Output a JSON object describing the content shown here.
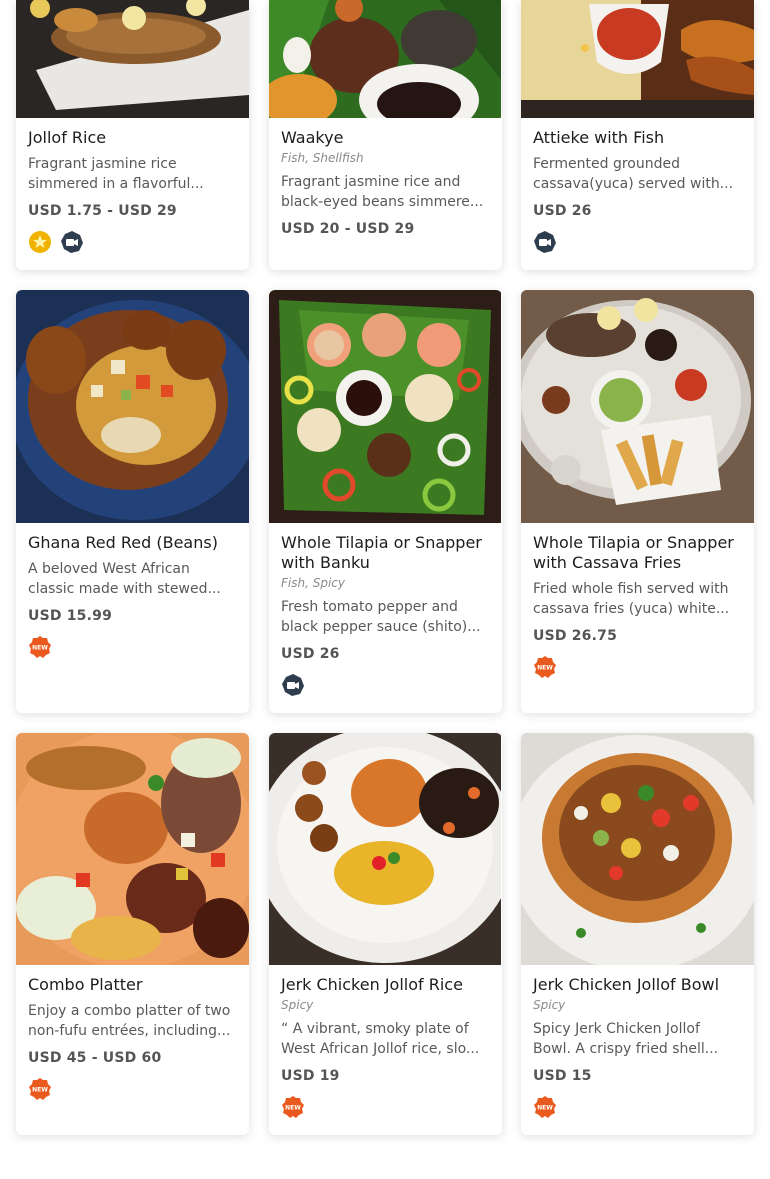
{
  "menu_items": [
    {
      "name": "Jollof Rice",
      "tags": "",
      "description": "Fragrant jasmine rice simmered in a flavorful...",
      "price": "USD 1.75 - USD 29",
      "badges": [
        "star-badge-icon",
        "video-badge-icon"
      ]
    },
    {
      "name": "Waakye",
      "tags": "Fish, Shellfish",
      "description": "Fragrant jasmine rice and black-eyed beans simmere...",
      "price": "USD 20 - USD 29",
      "badges": []
    },
    {
      "name": "Attieke with Fish",
      "tags": "",
      "description": "Fermented grounded cassava(yuca) served with...",
      "price": "USD 26",
      "badges": [
        "video-badge-icon"
      ]
    },
    {
      "name": "Ghana Red Red (Beans)",
      "tags": "",
      "description": "A beloved West African classic made with stewed...",
      "price": "USD 15.99",
      "badges": [
        "new-badge-icon"
      ],
      "badge_text": "NEW"
    },
    {
      "name": "Whole Tilapia or Snapper with Banku",
      "tags": "Fish, Spicy",
      "description": "Fresh tomato pepper and black pepper sauce (shito)...",
      "price": "USD 26",
      "badges": [
        "video-badge-icon"
      ]
    },
    {
      "name": "Whole Tilapia or Snapper with Cassava Fries",
      "tags": "",
      "description": "Fried whole fish served with cassava fries (yuca) white...",
      "price": "USD 26.75",
      "badges": [
        "new-badge-icon"
      ],
      "badge_text": "NEW"
    },
    {
      "name": "Combo Platter",
      "tags": "",
      "description": "Enjoy a combo platter of two non-fufu entrées, including...",
      "price": "USD 45 - USD 60",
      "badges": [
        "new-badge-icon"
      ],
      "badge_text": "NEW"
    },
    {
      "name": "Jerk Chicken Jollof Rice",
      "tags": "Spicy",
      "description": "“ A vibrant, smoky plate of West African Jollof rice, slo...",
      "price": "USD 19",
      "badges": [
        "new-badge-icon"
      ],
      "badge_text": "NEW"
    },
    {
      "name": "Jerk Chicken Jollof Bowl",
      "tags": "Spicy",
      "description": "Spicy Jerk Chicken Jollof Bowl. A crispy fried shell...",
      "price": "USD 15",
      "badges": [
        "new-badge-icon"
      ],
      "badge_text": "NEW"
    }
  ],
  "colors": {
    "star_badge": "#f0b400",
    "video_badge": "#2f3e4e",
    "new_badge": "#ea5a1e"
  }
}
